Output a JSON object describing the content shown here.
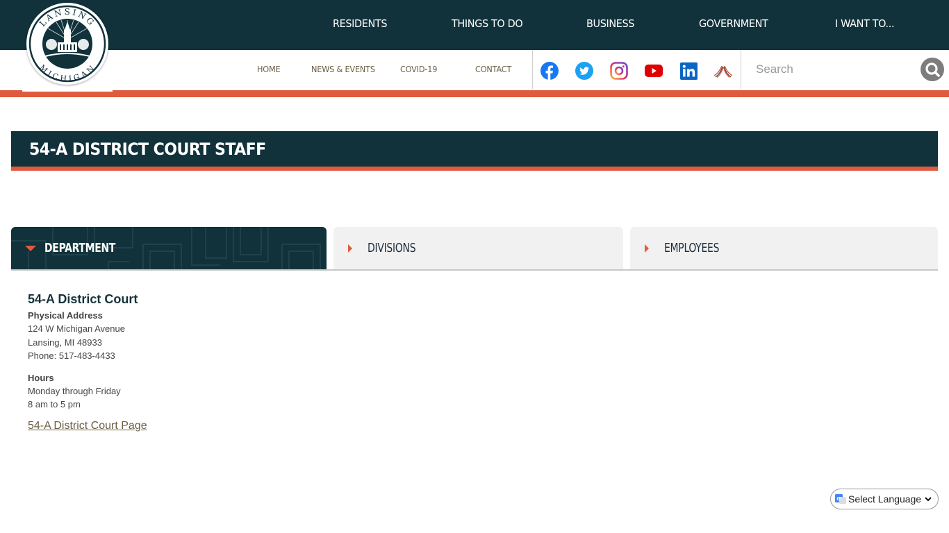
{
  "header": {
    "logo": {
      "alt": "Lansing Michigan city seal",
      "top_text": "LANSING",
      "bottom_text": "MICHIGAN"
    },
    "main_nav": [
      {
        "label": "RESIDENTS"
      },
      {
        "label": "THINGS TO DO"
      },
      {
        "label": "BUSINESS"
      },
      {
        "label": "GOVERNMENT"
      },
      {
        "label": "I WANT TO..."
      }
    ],
    "sub_nav": [
      {
        "label": "HOME"
      },
      {
        "label": "NEWS & EVENTS"
      },
      {
        "label": "COVID-19"
      },
      {
        "label": "CONTACT"
      }
    ],
    "social": [
      {
        "name": "facebook",
        "icon": "facebook-icon",
        "color": "#1877f2"
      },
      {
        "name": "twitter",
        "icon": "twitter-icon",
        "color": "#1da1f2"
      },
      {
        "name": "instagram",
        "icon": "instagram-icon",
        "color": "#c13584"
      },
      {
        "name": "youtube",
        "icon": "youtube-icon",
        "color": "#e00000"
      },
      {
        "name": "linkedin",
        "icon": "linkedin-icon",
        "color": "#0a66c2"
      },
      {
        "name": "lansing-arts",
        "icon": "arches-icon",
        "color": "#d6513c"
      }
    ],
    "search": {
      "placeholder": "Search",
      "value": "",
      "button_icon": "search-icon"
    }
  },
  "page": {
    "title": "54-A DISTRICT COURT STAFF"
  },
  "tabs": [
    {
      "label": "DEPARTMENT",
      "active": true
    },
    {
      "label": "DIVISIONS",
      "active": false
    },
    {
      "label": "EMPLOYEES",
      "active": false
    }
  ],
  "department": {
    "name": "54-A District Court",
    "address_heading": "Physical Address",
    "address_lines": [
      "124 W Michigan Avenue",
      "Lansing, MI 48933"
    ],
    "phone": "Phone: 517-483-4433",
    "hours_heading": "Hours",
    "hours_lines": [
      "Monday through Friday",
      "8 am to 5 pm"
    ],
    "link_text": "54-A District Court Page"
  },
  "translate": {
    "label": "Select Language"
  },
  "colors": {
    "brand_dark": "#11323b",
    "accent_orange": "#e05a3e",
    "nav_link": "#6b5d42",
    "tab_inactive_bg": "#f1f1f1"
  }
}
